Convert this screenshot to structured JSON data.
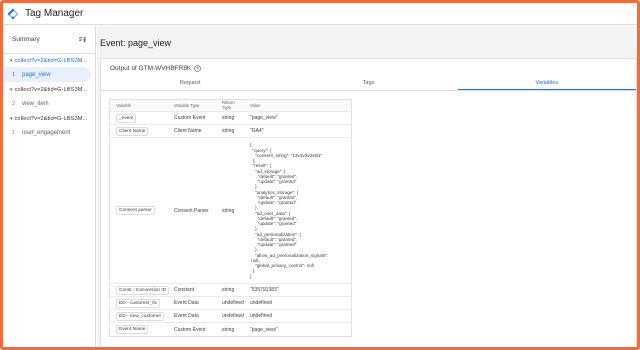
{
  "app": {
    "title": "Tag Manager",
    "logo_icon": "gtm-diamond-icon"
  },
  "sidebar": {
    "summary_label": "Summary",
    "delete_icon": "delete-sweep-icon",
    "groups": [
      {
        "message": "collect?v=2&tid=G-LBS3M...",
        "expanded": true,
        "events": [
          {
            "num": "1",
            "label": "page_view",
            "active": true
          }
        ]
      },
      {
        "message": "collect?v=2&tid=G-LBS3M...",
        "expanded": true,
        "events": [
          {
            "num": "2",
            "label": "view_item",
            "active": false
          }
        ]
      },
      {
        "message": "collect?v=2&tid=G-LBS3M...",
        "expanded": true,
        "events": [
          {
            "num": "1",
            "label": "user_engagement",
            "active": false
          }
        ]
      }
    ]
  },
  "main": {
    "title": "Event: page_view",
    "output_title": "Output of GTM-WVHBFR8K",
    "tabs": [
      "Request",
      "Tags",
      "Variables"
    ],
    "active_tab": 2,
    "table": {
      "headers": [
        "Variable",
        "Variable Type",
        "Return Type",
        "Value"
      ],
      "rows": [
        {
          "name": "_event",
          "type": "Custom Event",
          "ret": "string",
          "value": "\"page_view\""
        },
        {
          "name": "Client Name",
          "type": "Client Name",
          "ret": "string",
          "value": "\"GA4\""
        },
        {
          "name": "Consent parser",
          "type": "Consent Parser",
          "ret": "string",
          "value": "{\n  \"query\": {\n    \"consent_string\": \"13v3v3v3v5l1\"\n  },\n  \"result\": {\n    \"ad_storage\": {\n      \"default\": \"granted\",\n      \"update\": \"granted\"\n    },\n    \"analytics_storage\": {\n      \"default\": \"granted\",\n      \"update\": \"granted\"\n    },\n    \"ad_user_data\": {\n      \"default\": \"granted\",\n      \"update\": \"granted\"\n    },\n    \"ad_personalization\": {\n      \"default\": \"granted\",\n      \"update\": \"granted\"\n    },\n    \"allow_ad_personalization_signals\":\n null,\n    \"global_privacy_control\": null\n  }\n}"
        },
        {
          "name": "Const - Conversion ID",
          "type": "Constant",
          "ret": "string",
          "value": "\"535791383\""
        },
        {
          "name": "ED - customer_ltv",
          "type": "Event Data",
          "ret": "undefined",
          "value": "undefined"
        },
        {
          "name": "ED - new_customer",
          "type": "Event Data",
          "ret": "undefined",
          "value": "undefined"
        },
        {
          "name": "Event Name",
          "type": "Custom Event",
          "ret": "string",
          "value": "\"page_view\""
        }
      ]
    }
  },
  "colors": {
    "accent": "#1a73e8",
    "frame": "#f26b38",
    "active_bg": "#e8f0fe"
  }
}
